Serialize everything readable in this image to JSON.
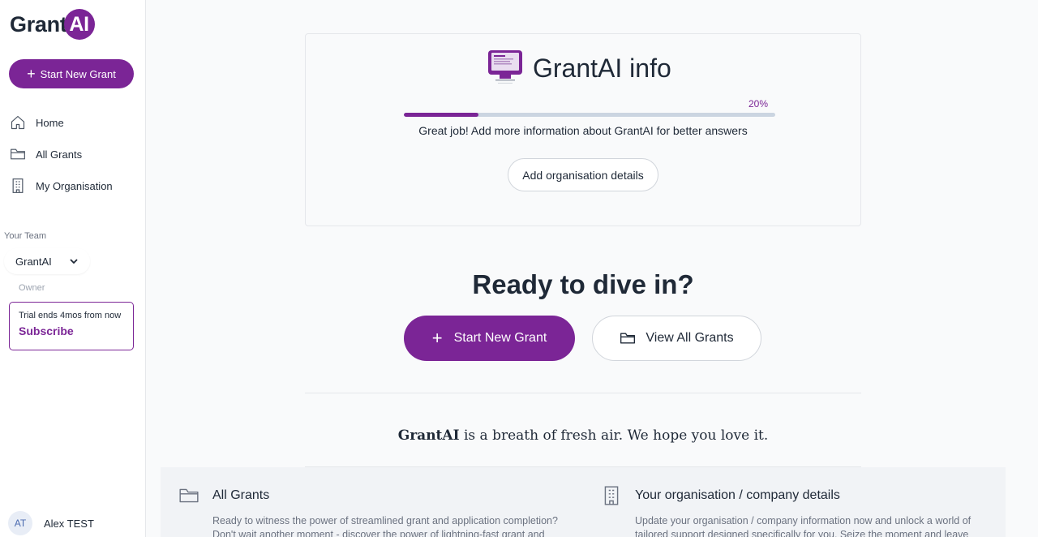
{
  "app": {
    "logo_text": "Grant",
    "logo_badge": "AI"
  },
  "sidebar": {
    "start_button": "Start New Grant",
    "items": [
      {
        "label": "Home",
        "icon": "home-icon"
      },
      {
        "label": "All Grants",
        "icon": "folder-icon"
      },
      {
        "label": "My Organisation",
        "icon": "building-icon"
      }
    ],
    "team_label": "Your Team",
    "team_name": "GrantAI",
    "team_role": "Owner",
    "trial_text": "Trial ends 4mos from now",
    "subscribe_label": "Subscribe",
    "user_initials": "AT",
    "user_name": "Alex TEST"
  },
  "info_card": {
    "title": "GrantAI info",
    "progress_label": "20%",
    "progress_value": 0.2,
    "message": "Great job! Add more information about GrantAI for better answers",
    "add_button": "Add organisation details"
  },
  "cta": {
    "heading": "Ready to dive in?",
    "start_button": "Start New Grant",
    "view_button": "View All Grants"
  },
  "tagline": {
    "brand": "GrantAI",
    "rest": "is a breath of fresh air. We hope you love it."
  },
  "features": [
    {
      "title": "All Grants",
      "icon": "folder-icon",
      "body": "Ready to witness the power of streamlined grant and application completion? Don't wait another moment - discover the power of lightning-fast grant and"
    },
    {
      "title": "Your organisation / company details",
      "icon": "building-icon",
      "body": "Update your organisation / company information now and unlock a world of tailored support designed specifically for you. Seize the moment and leave"
    }
  ],
  "colors": {
    "accent": "#7b2596"
  }
}
